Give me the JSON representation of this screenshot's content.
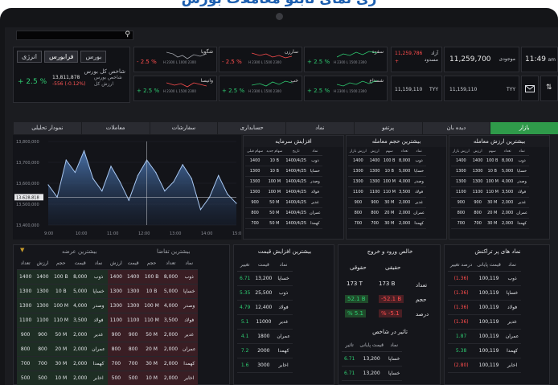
{
  "page": {
    "cut_title": "ری نمای تابلو معاملات بورس"
  },
  "search": {
    "icon": "search-icon"
  },
  "index_box": {
    "tabs": [
      "بورس",
      "فرابورس",
      "انرژی"
    ],
    "index_name": "شاخص کل بورس",
    "change": "+ 2.5 %",
    "value_top": "13,811,878",
    "value_bottom": "-556 (-0.12%)",
    "label_top": "شاخص بورس",
    "label_bottom": "ارزش کل"
  },
  "sparklines": [
    {
      "name": "شگویا",
      "change": "- 2.5 %",
      "mini": "H 2300  L 1000  2300",
      "color": "#ff4d4d"
    },
    {
      "name": "سارزن",
      "change": "- 2.5 %",
      "mini": "H 2300  L 1500  2300",
      "color": "#ff4d4d"
    },
    {
      "name": "سفوه",
      "change": "+ 2.5 %",
      "mini": "H 2300  L 1500  2300",
      "color": "#2ecc71"
    },
    {
      "name": "وانیسا",
      "change": "+ 2.5 %",
      "mini": "H 2300  L 1500  2300",
      "color": "#ff4d4d"
    },
    {
      "name": "خپ",
      "change": "+ 2.5 %",
      "mini": "H 2300  L 1500  2300",
      "color": "#2ecc71"
    },
    {
      "name": "شستاع",
      "change": "+ 2.5 %",
      "mini": "H 2300  L 1500  2300",
      "color": "#2ecc71"
    }
  ],
  "right_quotes": {
    "q1_val": "11,259,786",
    "q1_sub": "+",
    "q1_lbl": "آزاد",
    "q1_lbl2": "مسدود",
    "q2_val": "11,259,700",
    "q2_lbl": "موجودی",
    "q3_val": "11,159,110",
    "q3_sub": "TYY",
    "q4_val": "11,159,110",
    "q4_sub": "TYY",
    "time": "11:49",
    "time_sub": "am"
  },
  "main_tabs": [
    "نمودار تحلیلی",
    "معاملات",
    "سفارشات",
    "حسابداری",
    "نماد",
    "پرتفو",
    "دیده بان",
    "بازار"
  ],
  "chart_data": {
    "type": "area",
    "y_ticks": [
      "13,800,000",
      "13,700,000",
      "13,600,000",
      "13,500,000",
      "13,400,000"
    ],
    "x_ticks": [
      "9:00",
      "10:00",
      "11:00",
      "12:00",
      "13:00",
      "14:00",
      "15:00"
    ],
    "crosshair_label": "13,628,818",
    "values": [
      13680,
      13640,
      13760,
      13720,
      13790,
      13700,
      13660,
      13740,
      13690,
      13630,
      13710,
      13760,
      13720,
      13660,
      13690,
      13745,
      13700,
      13600,
      13640,
      13710,
      13650,
      13620
    ]
  },
  "panel_value_increase": {
    "title": "افزایش سرمایه",
    "headers": [
      "نماد",
      "تاریخ",
      "سهام جدید",
      "سهام قبلی"
    ],
    "rows": [
      [
        "ذوب",
        "1400/4/25",
        "10 B",
        "1400"
      ],
      [
        "خساپا",
        "1400/4/25",
        "10 B",
        "1300"
      ],
      [
        "وصدر",
        "1400/4/25",
        "100 M",
        "1300"
      ],
      [
        "فولاد",
        "1400/4/25",
        "100 M",
        "1300"
      ],
      [
        "غدیر",
        "1400/4/25",
        "50 M",
        "900"
      ],
      [
        "عمران",
        "1400/4/25",
        "50 M",
        "800"
      ],
      [
        "کهمدا",
        "1400/4/25",
        "50 M",
        "700"
      ]
    ]
  },
  "panel_most_volume": {
    "title": "بیشترین حجم معامله",
    "headers": [
      "نماد",
      "تعداد",
      "سهم",
      "ارزش",
      "ارزش بازار"
    ],
    "rows": [
      [
        "ذوب",
        "8,000",
        "100 B",
        "1400",
        "1400"
      ],
      [
        "خساپا",
        "5,000",
        "10 B",
        "1300",
        "1300"
      ],
      [
        "وصدر",
        "4,000",
        "100 M",
        "1300",
        "1300"
      ],
      [
        "فولاد",
        "3,500",
        "110 M",
        "1100",
        "1100"
      ],
      [
        "غدیر",
        "2,000",
        "30 M",
        "900",
        "900"
      ],
      [
        "عمران",
        "2,000",
        "20 M",
        "800",
        "800"
      ],
      [
        "کهمدا",
        "2,000",
        "30 M",
        "700",
        "700"
      ]
    ]
  },
  "panel_most_value": {
    "title": "بیشترین ارزش معامله",
    "headers": [
      "نماد",
      "تعداد",
      "سهم",
      "ارزش",
      "ارزش بازار"
    ],
    "rows": [
      [
        "ذوب",
        "8,000",
        "100 B",
        "1400",
        "1400"
      ],
      [
        "خساپا",
        "5,000",
        "10 B",
        "1300",
        "1300"
      ],
      [
        "وصدر",
        "4,000",
        "100 M",
        "1300",
        "1300"
      ],
      [
        "فولاد",
        "3,500",
        "110 M",
        "1100",
        "1100"
      ],
      [
        "غدیر",
        "2,000",
        "30 M",
        "900",
        "900"
      ],
      [
        "عمران",
        "2,000",
        "20 M",
        "800",
        "800"
      ],
      [
        "کهمدا",
        "2,000",
        "30 M",
        "700",
        "700"
      ]
    ]
  },
  "panel_effective": {
    "tabs": [
      "بیشترین عرضه",
      "بیشترین تقاضا"
    ],
    "headers": [
      "نماد",
      "تعداد",
      "حجم",
      "قیمت",
      "ارزش",
      "نماد",
      "قیمت",
      "حجم",
      "ارزش",
      "تعداد"
    ],
    "rows": [
      [
        "ذوب",
        "8,000",
        "100 B",
        "1400",
        "1400",
        "ذوب",
        "8,000",
        "100 B",
        "1400",
        "1400"
      ],
      [
        "خساپا",
        "5,000",
        "10 B",
        "1300",
        "1300",
        "خساپا",
        "5,000",
        "10 B",
        "1300",
        "1300"
      ],
      [
        "وصدر",
        "4,000",
        "100 M",
        "1300",
        "1300",
        "وصدر",
        "4,000",
        "100 M",
        "1300",
        "1300"
      ],
      [
        "فولاد",
        "3,500",
        "110 M",
        "1100",
        "1100",
        "فولاد",
        "3,500",
        "110 M",
        "1100",
        "1100"
      ],
      [
        "غدیر",
        "2,000",
        "50 M",
        "900",
        "900",
        "غدیر",
        "2,000",
        "50 M",
        "900",
        "900"
      ],
      [
        "عمران",
        "2,000",
        "20 M",
        "800",
        "800",
        "عمران",
        "2,000",
        "20 M",
        "800",
        "800"
      ],
      [
        "کهمدا",
        "2,000",
        "30 M",
        "700",
        "700",
        "کهمدا",
        "2,000",
        "30 M",
        "700",
        "700"
      ],
      [
        "اخابر",
        "2,000",
        "10 M",
        "500",
        "500",
        "اخابر",
        "2,000",
        "10 M",
        "500",
        "500"
      ]
    ]
  },
  "panel_price_increase": {
    "title": "بیشترین افزایش قیمت",
    "headers": [
      "نماد",
      "قیمت",
      "تغییر"
    ],
    "rows": [
      [
        "خساپا",
        "13,200",
        "6.71"
      ],
      [
        "ذوب",
        "25,500",
        "5.35"
      ],
      [
        "فولاد",
        "12,400",
        "4.79"
      ],
      [
        "غدیر",
        "11000",
        "5.1"
      ],
      [
        "عمران",
        "1800",
        "4.1"
      ],
      [
        "کهمدا",
        "2000",
        "7.2"
      ],
      [
        "اخابر",
        "3000",
        "1.6"
      ]
    ]
  },
  "panel_inout": {
    "title": "خالص ورود و خروج",
    "col_legal": "حقوقی",
    "col_real": "حقیقی",
    "r1_lbl": "تعداد",
    "r1_a": "173 T",
    "r1_b": "173 B",
    "r2_lbl": "حجم",
    "r2_a": "52.1 B",
    "r2_b": "-52.1 B",
    "r3_lbl": "درصد",
    "r3_a": "% 5.1",
    "r3_b": "% -5.1",
    "sub_title": "تاثیر در شاخص",
    "sub_headers": [
      "نماد",
      "قیمت پایانی",
      "تاثیر"
    ],
    "sub_rows": [
      [
        "خساپا",
        "13,200",
        "6.71"
      ],
      [
        "خساپا",
        "13,200",
        "6.71"
      ]
    ]
  },
  "panel_impact": {
    "title": "نماد های پر تراکنش",
    "headers": [
      "نماد",
      "قیمت پایانی",
      "درصد تغییر"
    ],
    "rows": [
      [
        "ذوب",
        "100,119",
        "(1.36)"
      ],
      [
        "خساپا",
        "100,119",
        "(1.36)"
      ],
      [
        "فولاد",
        "100,119",
        "(1.36)"
      ],
      [
        "غدیر",
        "100,119",
        "(1.36)"
      ],
      [
        "عمران",
        "100,119",
        "1.87"
      ],
      [
        "کهمدا",
        "100,119",
        "5.38"
      ],
      [
        "اخابر",
        "100,119",
        "(2.80)"
      ]
    ]
  },
  "colors": {
    "green": "#2ecc71",
    "red": "#ff4d4d",
    "accent": "#2f9a4a"
  }
}
